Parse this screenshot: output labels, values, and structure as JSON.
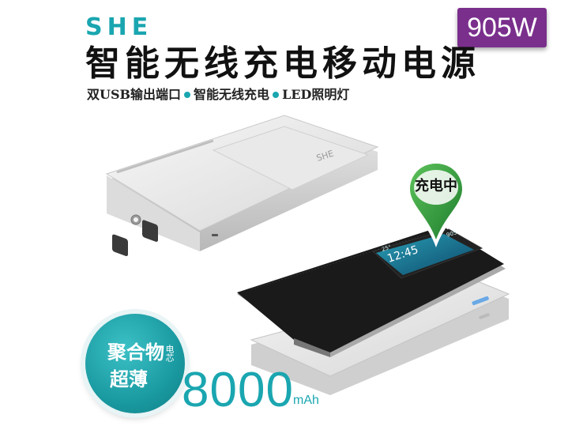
{
  "brand": {
    "logo_text": "SHE"
  },
  "badge": {
    "model": "905W"
  },
  "headline": "智能无线充电移动电源",
  "features": {
    "item1": "双USB输出端口",
    "item2": "智能无线充电",
    "item3": "LED照明灯"
  },
  "pin": {
    "label": "充电中"
  },
  "round_badge": {
    "line1": "聚合物",
    "small": "电芯",
    "line2": "超薄"
  },
  "capacity": {
    "value": "8000",
    "unit": "mAh"
  },
  "phone_screen": {
    "time": "12:45",
    "status_left": "25°",
    "status_right": "905"
  },
  "colors": {
    "accent": "#1aa6b0",
    "badge_bg": "#7a2f8c",
    "pin_green": "#2e9a3a"
  }
}
